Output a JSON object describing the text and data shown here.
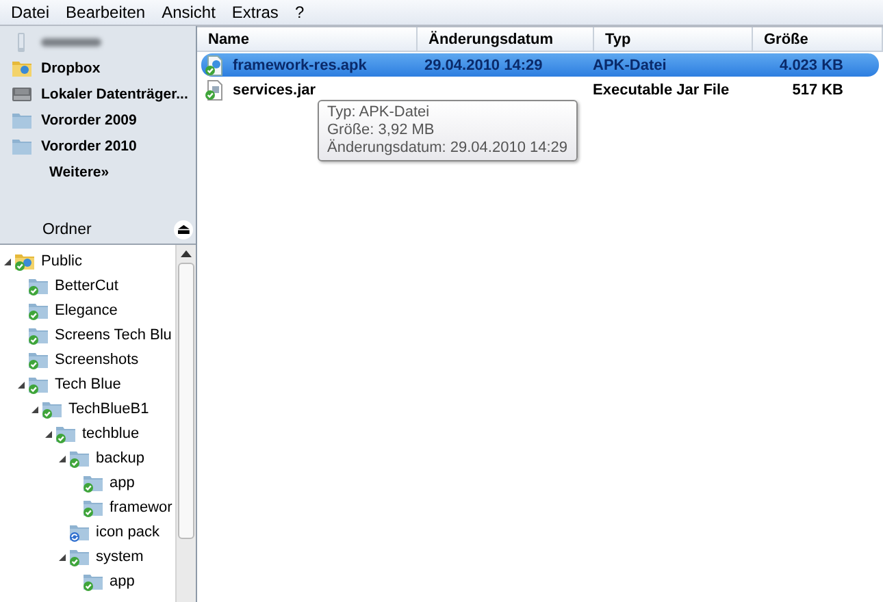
{
  "menu_bar": [
    "Datei",
    "Bearbeiten",
    "Ansicht",
    "Extras",
    "?"
  ],
  "favorites": [
    {
      "kind": "device"
    },
    {
      "kind": "dropbox",
      "label": "Dropbox"
    },
    {
      "kind": "drive",
      "label": "Lokaler Datenträger..."
    },
    {
      "kind": "folder",
      "label": "Vororder 2009"
    },
    {
      "kind": "folder",
      "label": "Vororder 2010"
    },
    {
      "kind": "more",
      "label": "Weitere",
      "arrow": "»"
    }
  ],
  "folders_header": {
    "label": "Ordner",
    "eject": "⏏"
  },
  "tree": [
    {
      "label": "Public",
      "expanded": true,
      "synced": true,
      "children": [
        {
          "label": "BetterCut",
          "synced": true
        },
        {
          "label": "Elegance",
          "synced": true
        },
        {
          "label": "Screens Tech Blu",
          "synced": true
        },
        {
          "label": "Screenshots",
          "synced": true
        },
        {
          "label": "Tech Blue",
          "expanded": true,
          "synced": true,
          "children": [
            {
              "label": "TechBlueB1",
              "expanded": true,
              "synced": true,
              "children": [
                {
                  "label": "techblue",
                  "expanded": true,
                  "synced": true,
                  "children": [
                    {
                      "label": "backup",
                      "expanded": true,
                      "synced": true,
                      "children": [
                        {
                          "label": "app",
                          "synced": true
                        },
                        {
                          "label": "framewor",
                          "synced": true
                        }
                      ]
                    },
                    {
                      "label": "icon pack",
                      "synced": false
                    },
                    {
                      "label": "system",
                      "expanded": true,
                      "synced": true,
                      "children": [
                        {
                          "label": "app",
                          "synced": true
                        }
                      ]
                    }
                  ]
                }
              ]
            }
          ]
        }
      ]
    }
  ],
  "table": {
    "columns": [
      "Name",
      "Änderungsdatum",
      "Typ",
      "Größe"
    ],
    "rows": [
      {
        "kind": "apk",
        "name": "framework-res.apk",
        "date": "29.04.2010 14:29",
        "type": "APK-Datei",
        "size": "4.023 KB",
        "selected": true
      },
      {
        "kind": "jar",
        "name": "services.jar",
        "type": "Executable Jar File",
        "size": "517 KB",
        "selected": false
      }
    ]
  },
  "tooltip": [
    "Typ: APK-Datei",
    "Größe: 3,92 MB",
    "Änderungsdatum: 29.04.2010 14:29"
  ]
}
